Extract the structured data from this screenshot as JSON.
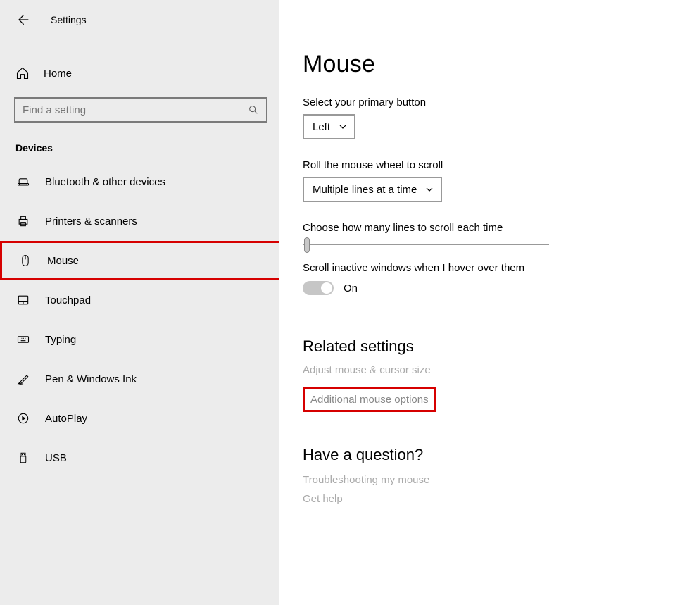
{
  "header": {
    "title": "Settings"
  },
  "sidebar": {
    "home_label": "Home",
    "search_placeholder": "Find a setting",
    "section_label": "Devices",
    "items": [
      {
        "label": "Bluetooth & other devices"
      },
      {
        "label": "Printers & scanners"
      },
      {
        "label": "Mouse"
      },
      {
        "label": "Touchpad"
      },
      {
        "label": "Typing"
      },
      {
        "label": "Pen & Windows Ink"
      },
      {
        "label": "AutoPlay"
      },
      {
        "label": "USB"
      }
    ]
  },
  "main": {
    "title": "Mouse",
    "primary_button_label": "Select your primary button",
    "primary_button_value": "Left",
    "scroll_mode_label": "Roll the mouse wheel to scroll",
    "scroll_mode_value": "Multiple lines at a time",
    "lines_label": "Choose how many lines to scroll each time",
    "hover_label": "Scroll inactive windows when I hover over them",
    "hover_value": "On",
    "related_heading": "Related settings",
    "related_link1": "Adjust mouse & cursor size",
    "related_link2": "Additional mouse options",
    "question_heading": "Have a question?",
    "question_link1": "Troubleshooting my mouse",
    "question_link2": "Get help"
  }
}
